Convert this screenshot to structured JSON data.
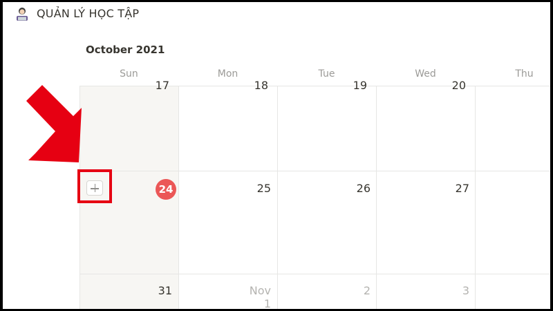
{
  "header": {
    "title": "QUẢN LÝ HỌC TẬP"
  },
  "calendar": {
    "month_label": "October 2021",
    "weekdays": [
      "Sun",
      "Mon",
      "Tue",
      "Wed",
      "Thu"
    ],
    "week1": [
      "17",
      "18",
      "19",
      "20"
    ],
    "week2": [
      "24",
      "25",
      "26",
      "27"
    ],
    "week3": [
      "31",
      "Nov 1",
      "2",
      "3"
    ],
    "today": "24",
    "today_color": "#eb5757"
  },
  "icons": {
    "page": "person-at-laptop-icon",
    "add": "plus-icon",
    "annotation": "red-arrow-icon"
  },
  "colors": {
    "accent_red": "#e60012",
    "sunday_column": "#f7f6f3",
    "text": "#37352f",
    "muted": "#9b9a97"
  }
}
